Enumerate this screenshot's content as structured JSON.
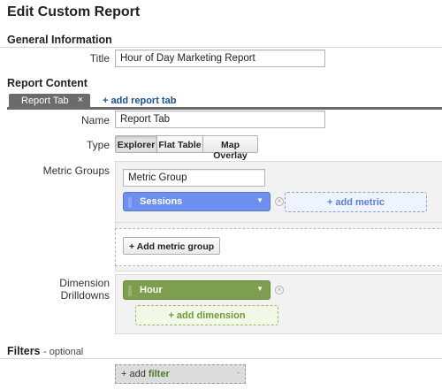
{
  "page": {
    "title": "Edit Custom Report"
  },
  "general": {
    "heading": "General Information",
    "title_label": "Title",
    "title_value": "Hour of Day Marketing Report"
  },
  "content": {
    "heading": "Report Content",
    "tabs": [
      {
        "label": "Report Tab",
        "close": "×"
      }
    ],
    "add_tab": "+ add report tab",
    "name_label": "Name",
    "name_value": "Report Tab",
    "type_label": "Type",
    "types": [
      {
        "label": "Explorer",
        "selected": true
      },
      {
        "label": "Flat Table",
        "selected": false
      },
      {
        "label": "Map Overlay",
        "selected": false
      }
    ],
    "metric_groups_label": "Metric Groups",
    "metric_group_name": "Metric Group",
    "metric": {
      "label": "Sessions",
      "color": "#6d8ff0"
    },
    "add_metric": "+ add metric",
    "add_metric_group": "+ Add metric group",
    "dimension_label": "Dimension Drilldowns",
    "dimension": {
      "label": "Hour",
      "color": "#7e9e4f"
    },
    "add_dimension": "+ add dimension"
  },
  "filters": {
    "heading": "Filters",
    "optional": "- optional",
    "add_prefix": "+ add",
    "add_word": "filter",
    "caret": "-"
  },
  "icons": {
    "remove": "close-circle-icon",
    "dropdown": "caret-down-icon",
    "drag": "drag-handle-icon"
  }
}
